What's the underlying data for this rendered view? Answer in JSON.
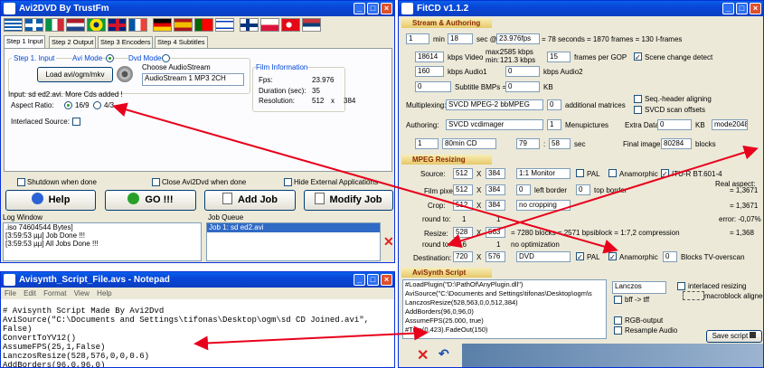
{
  "avi2dvd": {
    "title": "Avi2DVD By TrustFm",
    "tabs": [
      "Step 1 Input",
      "Step 2 Output",
      "Step 3 Encoders",
      "Step 4 Subtitles"
    ],
    "step1": "Step 1. Input",
    "avi_mode": "Avi Mode",
    "dvd_mode": "Dvd Mode",
    "load_btn": "Load avi/ogm/mkv",
    "choose_audio": "Choose AudioStream",
    "audio_value": "AudioStream 1 MP3 2CH",
    "film_info": "Film Information",
    "fps_label": "Fps:",
    "fps": "23.976",
    "duration_label": "Duration (sec):",
    "duration": "35",
    "res_label": "Resolution:",
    "res_w": "512",
    "res_x": "x",
    "res_h": "384",
    "input_msg": "Input: sd ed2.avi. More Cds added !",
    "aspect_label": "Aspect Ratio:",
    "ar169": "16/9",
    "ar43": "4/3",
    "interlaced": "Interlaced Source:",
    "shutdown": "Shutdown when done",
    "close": "Close Avi2Dvd when done",
    "hide_ext": "Hide External Applications",
    "help_btn": "Help",
    "go_btn": "GO !!!",
    "addjob_btn": "Add Job",
    "modifyjob_btn": "Modify Job",
    "log_window": "Log Window",
    "job_queue": "Job Queue",
    "log": [
      ".iso 74604544 Bytes]",
      "[3:59:53 µµ] Job Done !!!",
      "[3:59:53 µµ] All Jobs Done !!!"
    ],
    "jobs": [
      "Job 1: sd ed2.avi"
    ]
  },
  "notepad": {
    "title": "Avisynth_Script_File.avs - Notepad",
    "menu": [
      "File",
      "Edit",
      "Format",
      "View",
      "Help"
    ],
    "lines": [
      "# Avisynth Script Made By Avi2Dvd",
      "AviSource(\"C:\\Documents and Settings\\tifonas\\Desktop\\ogm\\sd CD Joined.avi\",",
      "False)",
      "ConvertToYV12()",
      "AssumeFPS(25,1,False)",
      "LanczosResize(528,576,0,0,0.6)",
      "AddBorders(96,0,96,0)"
    ]
  },
  "fitcd": {
    "title": "FitCD v1.1.2",
    "sec_authoring": "Stream & Authoring",
    "min": "1",
    "min_label": "min",
    "sec": "18",
    "sec_label": "sec @",
    "fps": "23.976fps",
    "frames_calc": "= 78 seconds = 1870 frames = 130 I-frames",
    "video_kbps": "18614",
    "kbps_video": "kbps Video",
    "max_label": "max:",
    "max_val": "2585 kbps",
    "min_label2": "min:",
    "min_val": "121.3 kbps",
    "gop": "15",
    "frames_gop": "frames per GOP",
    "scene": "Scene change detect",
    "audio1": "160",
    "kbps_audio1": "kbps Audio1",
    "audio2": "0",
    "kbps_audio2": "kbps Audio2",
    "sub_bmps": "0",
    "subtitle_bmps": "Subtitle BMPs =",
    "sub_kb": "0",
    "kb": "KB",
    "multiplexing": "Multiplexing:",
    "mux": "SVCD MPEG-2 bbMPEG",
    "matrices": "0",
    "additional_matrices": "additional matrices",
    "seq_align": "Seq.-header aligning",
    "svcd_scan": "SVCD scan offsets",
    "authoring_label": "Authoring:",
    "auth": "SVCD vcdimager",
    "menupics": "1",
    "menupictures": "Menupictures",
    "extra_label": "Extra Data:",
    "extra": "0",
    "extra_kb": "KB",
    "mode": "mode2048",
    "cd1": "1",
    "cd_type": "80min CD",
    "cd_min": "79",
    "cd_sec": "58",
    "cd_seclabel": "sec",
    "final_image": "Final image:",
    "final_blocks": "80284",
    "blocks": "blocks",
    "sec_mpeg": "MPEG Resizing",
    "source_label": "Source:",
    "src_w": "512",
    "src_h": "384",
    "monitor": "1:1 Monitor",
    "pal": "PAL",
    "anamorphic": "Anamorphic",
    "itu": "ITU-R BT.601-4",
    "filmpixel_label": "Film pixel:",
    "fp_w": "512",
    "fp_h": "384",
    "left_border": "left border",
    "lb": "0",
    "top_border": "top border",
    "tb": "0",
    "crop_label": "Crop:",
    "crop_w": "512",
    "crop_h": "384",
    "no_crop": "no cropping",
    "roundto_label": "round to:",
    "rt1": "1",
    "rt2": "1",
    "resize_label": "Resize:",
    "rs_w": "528",
    "rs_h": "563",
    "resize_calc": "= 7280 blocks = 2571 bpsiblock = 1:7,2 compression",
    "roundto2_label": "round to:",
    "rt3": "16",
    "rt4": "1",
    "no_opt": "no optimization",
    "dest_label": "Destination:",
    "dest_w": "720",
    "dest_h": "576",
    "dest_fmt": "DVD",
    "dest_pal": "PAL",
    "dest_ana": "Anamorphic",
    "blocks_tv": "Blocks TV-overscan",
    "blocks_val": "0",
    "real_aspect": "Real aspect:",
    "ra1": "= 1,3671",
    "ra2": "= 1,3671",
    "error": "error: -0,07%",
    "ra3": "= 1,368",
    "sec_avs": "AviSynth Script",
    "avs": [
      "#LoadPlugin(\"D:\\PathOf\\AnyPlugin.dll\")",
      "AviSource(\"C:\\Documents and Settings\\tifonas\\Desktop\\ogm\\s",
      "LanczosResize(528,563,0,0,512,384)",
      "AddBorders(96,0,96,0)",
      "AssumeFPS(25.000, true)",
      "#Trim(0,423).FadeOut(150)"
    ],
    "resize_method": "Lanczos",
    "interlaced_resizing": "interlaced resizing",
    "bff": "bff -> tff",
    "macroblock": "macroblock aligned",
    "rgb": "RGB-output",
    "resample": "Resample Audio",
    "save": "Save script"
  }
}
